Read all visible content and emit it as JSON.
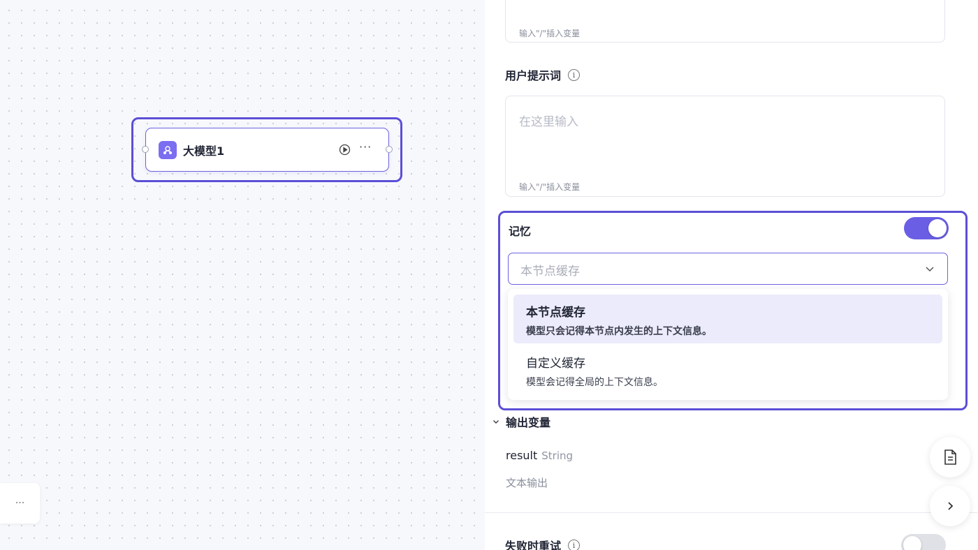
{
  "canvas": {
    "node": {
      "title": "大模型1",
      "more_label": "···"
    },
    "corner_button_label": "···"
  },
  "panel": {
    "system_prompt": {
      "hint": "输入\"/\"插入变量"
    },
    "user_prompt": {
      "label": "用户提示词",
      "info": "i",
      "placeholder": "在这里输入",
      "hint": "输入\"/\"插入变量"
    },
    "memory": {
      "label": "记忆",
      "enabled": true,
      "selected_value": "本节点缓存",
      "options": [
        {
          "title": "本节点缓存",
          "description": "模型只会记得本节点内发生的上下文信息。",
          "selected": true
        },
        {
          "title": "自定义缓存",
          "description": "模型会记得全局的上下文信息。",
          "selected": false
        }
      ]
    },
    "output": {
      "label": "输出变量",
      "variable_name": "result",
      "variable_type": "String",
      "variable_description": "文本输出"
    },
    "retry": {
      "label": "失败时重试",
      "info": "i",
      "enabled": false
    }
  },
  "colors": {
    "accent": "#5b4fd6",
    "toggle_on": "#6a5ee4",
    "selected_option_bg": "#ecebfb"
  },
  "icons": {
    "node": "llm-brain-icon",
    "run": "play-circle-icon",
    "doc": "document-icon",
    "expand": "chevron-right-icon",
    "section": "chevron-down-icon"
  }
}
